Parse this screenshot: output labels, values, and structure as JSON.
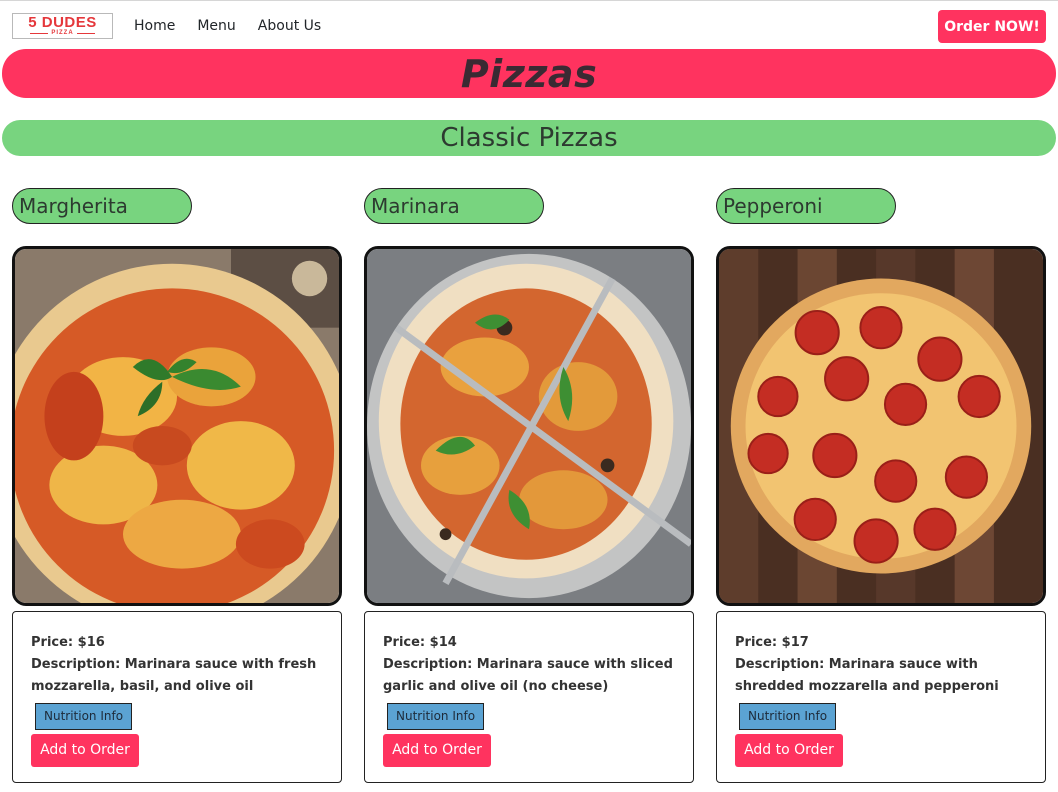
{
  "navbar": {
    "logo_main": "5 DUDES",
    "logo_sub": "PIZZA",
    "links": [
      "Home",
      "Menu",
      "About Us"
    ],
    "order_now_label": "Order NOW!"
  },
  "page_title": "Pizzas",
  "section_title": "Classic Pizzas",
  "pizzas": [
    {
      "name": "Margherita",
      "price": "Price: $16",
      "description": "Description: Marinara sauce with fresh mozzarella, basil, and olive oil",
      "nutrition_label": "Nutrition Info",
      "add_label": "Add to Order",
      "image_icon": "margherita-pizza-photo"
    },
    {
      "name": "Marinara",
      "price": "Price: $14",
      "description": "Description: Marinara sauce with sliced garlic and olive oil (no cheese)",
      "nutrition_label": "Nutrition Info",
      "add_label": "Add to Order",
      "image_icon": "marinara-pizza-photo"
    },
    {
      "name": "Pepperoni",
      "price": "Price: $17",
      "description": "Description: Marinara sauce with shredded mozzarella and pepperoni",
      "nutrition_label": "Nutrition Info",
      "add_label": "Add to Order",
      "image_icon": "pepperoni-pizza-photo"
    }
  ],
  "colors": {
    "accent_pink": "#ff335f",
    "accent_green": "#78d47f",
    "nutrition_blue": "#5ba3d3"
  }
}
